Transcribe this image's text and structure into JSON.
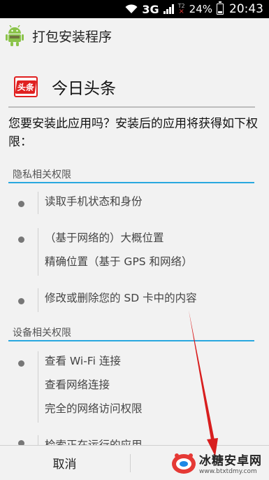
{
  "status_bar": {
    "network": "3G",
    "sim_label": "T2",
    "battery": "24%",
    "battery_level": 0.24,
    "time": "20:43"
  },
  "title_bar": {
    "title": "打包安装程序",
    "icon": "android-icon"
  },
  "app": {
    "name": "今日头条",
    "logo_text": "头条"
  },
  "prompt": "您要安装此应用吗？安装后的应用将获得如下权限：",
  "sections": [
    {
      "title": "隐私相关权限",
      "groups": [
        {
          "items": [
            "读取手机状态和身份"
          ]
        },
        {
          "items": [
            "（基于网络的）大概位置",
            "精确位置（基于 GPS 和网络）"
          ]
        },
        {
          "items": [
            "修改或删除您的 SD 卡中的内容"
          ]
        }
      ]
    },
    {
      "title": "设备相关权限",
      "groups": [
        {
          "items": [
            "查看 Wi-Fi 连接",
            "查看网络连接",
            "完全的网络访问权限"
          ]
        },
        {
          "items": [
            "检索正在运行的应用"
          ]
        }
      ]
    }
  ],
  "buttons": {
    "cancel": "取消"
  },
  "watermark": {
    "title": "冰糖安卓网",
    "url": "www.btxtdmy.com"
  },
  "colors": {
    "accent": "#29a8df",
    "annotation_arrow": "#d81e1e",
    "app_brand": "#e02020"
  }
}
